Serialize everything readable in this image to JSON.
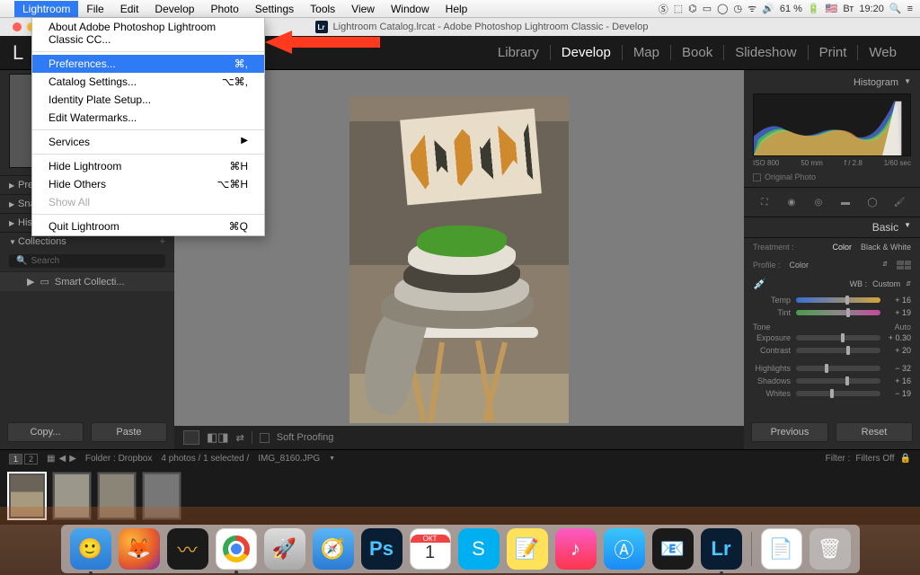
{
  "mac_menu": {
    "app": "Lightroom",
    "items": [
      "File",
      "Edit",
      "Develop",
      "Photo",
      "Settings",
      "Tools",
      "View",
      "Window",
      "Help"
    ],
    "status": {
      "battery": "61 %",
      "flag": "🇺🇸",
      "day": "Вт",
      "time": "19:20"
    }
  },
  "window_title": "Lightroom Catalog.lrcat - Adobe Photoshop Lightroom Classic - Develop",
  "dropdown": {
    "about": "About Adobe Photoshop Lightroom Classic CC...",
    "preferences": "Preferences...",
    "preferences_sc": "⌘,",
    "catalog": "Catalog Settings...",
    "catalog_sc": "⌥⌘,",
    "identity": "Identity Plate Setup...",
    "watermarks": "Edit Watermarks...",
    "services": "Services",
    "hide_lr": "Hide Lightroom",
    "hide_lr_sc": "⌘H",
    "hide_others": "Hide Others",
    "hide_others_sc": "⌥⌘H",
    "show_all": "Show All",
    "quit": "Quit Lightroom",
    "quit_sc": "⌘Q"
  },
  "lr_logo": "L",
  "modules": [
    "Library",
    "Develop",
    "Map",
    "Book",
    "Slideshow",
    "Print",
    "Web"
  ],
  "active_module": "Develop",
  "left": {
    "presets": "Presets",
    "snapshots": "Snapshots",
    "history": "History",
    "collections": "Collections",
    "search_ph": "Search",
    "smart": "Smart Collecti...",
    "copy": "Copy...",
    "paste": "Paste"
  },
  "center": {
    "soft_proof": "Soft Proofing"
  },
  "right": {
    "histogram": "Histogram",
    "histo_info": {
      "iso": "ISO 800",
      "mm": "50 mm",
      "f": "f / 2.8",
      "shutter": "1/60 sec"
    },
    "original": "Original Photo",
    "basic": "Basic",
    "treatment_lbl": "Treatment :",
    "color": "Color",
    "bw": "Black & White",
    "profile_lbl": "Profile :",
    "profile_val": "Color",
    "wb_lbl": "WB :",
    "wb_val": "Custom",
    "temp": "Temp",
    "temp_val": "+ 16",
    "tint": "Tint",
    "tint_val": "+ 19",
    "tone": "Tone",
    "auto": "Auto",
    "exposure": "Exposure",
    "exposure_val": "+ 0.30",
    "contrast": "Contrast",
    "contrast_val": "+ 20",
    "highlights": "Highlights",
    "highlights_val": "− 32",
    "shadows": "Shadows",
    "shadows_val": "+ 16",
    "whites": "Whites",
    "whites_val": "− 19",
    "previous": "Previous",
    "reset": "Reset"
  },
  "info_bar": {
    "pages": [
      "1",
      "2"
    ],
    "folder": "Folder : Dropbox",
    "count": "4 photos / 1 selected /",
    "filename": "IMG_8160.JPG",
    "filter_lbl": "Filter :",
    "filter_val": "Filters Off"
  },
  "dock": {
    "cal_month": "ОКТ",
    "cal_day": "1",
    "ps": "Ps",
    "lr": "Lr",
    "skype": "S"
  }
}
